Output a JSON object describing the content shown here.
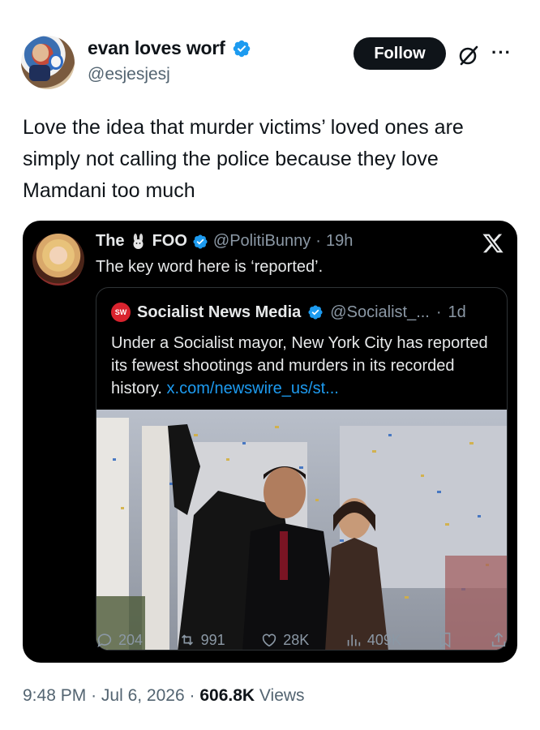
{
  "author": {
    "display_name": "evan loves worf",
    "handle": "@esjesjesj",
    "verified": true
  },
  "header_actions": {
    "follow_label": "Follow",
    "more_glyph": "···"
  },
  "tweet": {
    "text": "Love the idea that murder victims’ loved ones are simply not calling the police because they love Mamdani too much"
  },
  "quoted_post": {
    "name_prefix": "The",
    "name_suffix": "FOO",
    "handle": "@PolitiBunny",
    "separator": "·",
    "time": "19h",
    "text": "The key word here is ‘reported’.",
    "inner_quote": {
      "logo_text": "SW",
      "name": "Socialist News Media",
      "handle": "@Socialist_...",
      "separator": "·",
      "time": "1d",
      "text": "Under a Socialist mayor, New York City has reported its fewest shootings and murders in its recorded history.",
      "link": "x.com/newswire_us/st..."
    },
    "metrics": {
      "replies": "204",
      "reposts": "991",
      "likes": "28K",
      "views": "409K"
    }
  },
  "footer": {
    "time": "9:48 PM",
    "separator": "·",
    "date": "Jul 6, 2026",
    "views_count": "606.8K",
    "views_label": "Views"
  },
  "colors": {
    "verified_blue": "#1d9bf0",
    "card_bg": "#000000",
    "muted": "#536471",
    "logo_red": "#d9232e"
  },
  "icons": [
    "verified-badge-icon",
    "grok-icon",
    "more-icon",
    "x-logo-icon",
    "reply-icon",
    "repost-icon",
    "like-icon",
    "views-icon",
    "bookmark-icon",
    "share-icon"
  ]
}
